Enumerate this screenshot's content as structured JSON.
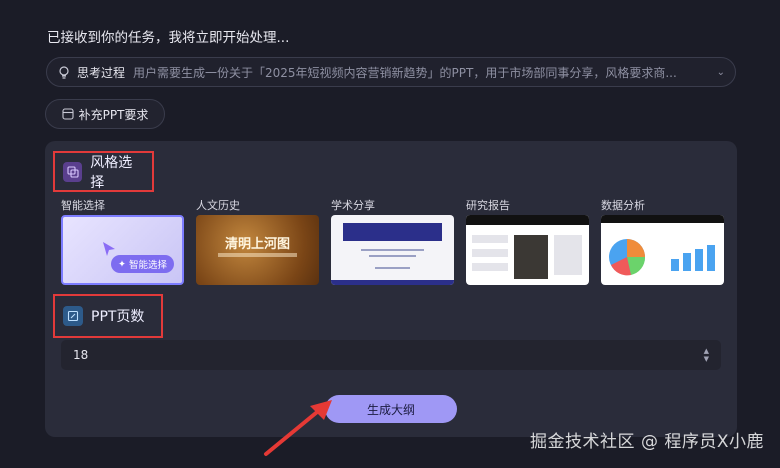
{
  "status_text": "已接收到你的任务，我将立即开始处理...",
  "thinking": {
    "label": "思考过程",
    "text": "用户需要生成一份关于「2025年短视频内容营销新趋势」的PPT，用于市场部同事分享，风格要求商...",
    "icon": "lightbulb-icon"
  },
  "supplement_button": "补充PPT要求",
  "style_section": {
    "title": "风格选择",
    "options": [
      {
        "name": "智能选择",
        "badge": "智能选择",
        "selected": true
      },
      {
        "name": "人文历史",
        "thumb_title": "清明上河图"
      },
      {
        "name": "学术分享"
      },
      {
        "name": "研究报告"
      },
      {
        "name": "数据分析"
      }
    ]
  },
  "pages_section": {
    "title": "PPT页数",
    "value": "18"
  },
  "generate_button": "生成大纲",
  "watermark": "掘金技术社区 @ 程序员X小鹿",
  "colors": {
    "accent": "#9f98f5",
    "highlight_border": "#e23a3a",
    "arrow": "#e53935"
  }
}
